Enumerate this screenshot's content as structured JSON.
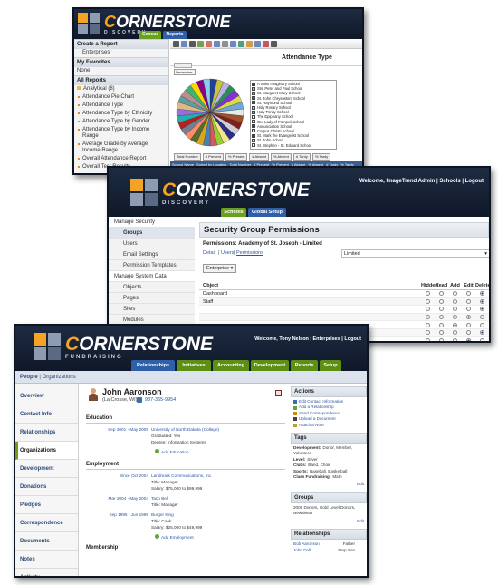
{
  "colors": {
    "navy": "#131d30",
    "green": "#5e8f15",
    "orange": "#f4a324",
    "link": "#2a56a3"
  },
  "brand": {
    "name_c": "C",
    "name_rest": "ORNERSTONE",
    "sub1": "DISCOVERY",
    "sub3": "FUNDRAISING"
  },
  "window1": {
    "tabs": [
      "Census",
      "Reports"
    ],
    "sidebar": {
      "create_header": "Create a Report",
      "create_item": "Enterprises",
      "favorites_header": "My Favorites",
      "favorites_item": "None",
      "all_header": "All Reports",
      "folder": "Analytical (8)",
      "items": [
        "Attendance Pie Chart",
        "Attendance Type",
        "Attendance Type by Ethnicity",
        "Attendance Type by Gender",
        "Attendance Type by Income Range",
        "Average Grade by Average Income Range",
        "Overall Attendance Report",
        "Overall Test Results"
      ]
    },
    "report_title": "Attendance Type",
    "filter_value": "December",
    "legend": [
      {
        "label": "A Saint Imaginary School",
        "color": "#1f3f9a"
      },
      {
        "label": "Sts. Peter and Paul School",
        "color": "#c9c23a"
      },
      {
        "label": "St. Margaret Mary School",
        "color": "#b5b5e0"
      },
      {
        "label": "St. John Chrysostom School",
        "color": "#2e8b57"
      },
      {
        "label": "St. Raymond School",
        "color": "#8a2be2"
      },
      {
        "label": "Holy Rosary School",
        "color": "#d9d94a"
      },
      {
        "label": "Holy Trinity School",
        "color": "#6fa8dc"
      },
      {
        "label": "The Epiphany School",
        "color": "#ffffff"
      },
      {
        "label": "Our Lady of Pompeii School",
        "color": "#ffffff"
      },
      {
        "label": "Annunciation School",
        "color": "#7f1f1f"
      },
      {
        "label": "Corpus Christi School",
        "color": "#e0e0e0"
      },
      {
        "label": "St. Mark the Evangelist School",
        "color": "#1f3f9a"
      },
      {
        "label": "St. John School",
        "color": "#ffffff"
      },
      {
        "label": "St. Stephen - St. Edward School",
        "color": "#ffffff"
      }
    ],
    "bottom_buttons": [
      "Total Number",
      "# Present",
      "% Present",
      "# Absent",
      "% Absent",
      "# Tardy",
      "% Tardy"
    ],
    "grid_header": [
      "School Name",
      "Sorted by Location",
      "Total Number",
      "# Present",
      "% Present",
      "# Absent",
      "% Absent",
      "# Tardy",
      "% Tardy"
    ],
    "nav_behind": [
      "Enterprise",
      "School",
      "Classroom",
      "Home",
      "Outcomes",
      "Finance",
      "Discovery",
      "Alumni",
      "Fundraising"
    ]
  },
  "window2": {
    "welcome": "Welcome, ImageTrend Admin | Schools | Logout",
    "tabs": [
      "Schools",
      "Global Setup"
    ],
    "sidebar": [
      {
        "label": "Manage Security",
        "type": "head"
      },
      {
        "label": "Groups",
        "type": "active"
      },
      {
        "label": "Users",
        "type": "sub"
      },
      {
        "label": "Email Settings",
        "type": "sub"
      },
      {
        "label": "Permission Templates",
        "type": "sub"
      },
      {
        "label": "Manage System Data",
        "type": "head"
      },
      {
        "label": "Objects",
        "type": "sub"
      },
      {
        "label": "Pages",
        "type": "sub"
      },
      {
        "label": "Sites",
        "type": "sub"
      },
      {
        "label": "Modules",
        "type": "sub"
      }
    ],
    "title": "Security Group Permissions",
    "subtitle": "Permissions: Academy of St. Joseph - Limited",
    "links": [
      "Detail",
      "Users",
      "Permissions"
    ],
    "select_value": "Limited",
    "enterprise_button": "Enterprise",
    "columns": [
      "Object",
      "Hidden",
      "Read",
      "Add",
      "Edit",
      "Delete"
    ],
    "rows": [
      {
        "name": "Dashboard",
        "sel": 4
      },
      {
        "name": "Staff",
        "sel": 4
      },
      {
        "name": "",
        "sel": 4
      },
      {
        "name": "",
        "sel": 3
      },
      {
        "name": "",
        "sel": 2
      },
      {
        "name": "",
        "sel": 4
      },
      {
        "name": "",
        "sel": 3
      },
      {
        "name": "",
        "sel": 4
      },
      {
        "name": "",
        "sel": 3
      },
      {
        "name": "",
        "sel": 4
      },
      {
        "name": "",
        "sel": 1
      },
      {
        "name": "",
        "sel": 4
      },
      {
        "name": "",
        "sel": 3
      },
      {
        "name": "",
        "sel": 4
      }
    ]
  },
  "window3": {
    "welcome": "Welcome, Tony Nelson | Enterprises | Logout",
    "tabs": [
      "Relationships",
      "Initiatives",
      "Accounting",
      "Development",
      "Reports",
      "Setup"
    ],
    "subbar": [
      "People",
      "Organizations"
    ],
    "sidebar": [
      "Overview",
      "Contact Info",
      "Relationships",
      "Organizations",
      "Development",
      "Donations",
      "Pledges",
      "Correspondence",
      "Documents",
      "Notes",
      "Activity"
    ],
    "active_sidebar": "Organizations",
    "person": {
      "name": "John Aaronson",
      "location": "(La Crosse, WI)",
      "phone": "987-365-9954"
    },
    "education_header": "Education",
    "education": [
      {
        "date": "Sep 2001 - May 2005",
        "lines": [
          "University of North Dakota (College)",
          "Graduated: Yes",
          "Degree: Information Systems"
        ]
      }
    ],
    "add_education": "Add Education",
    "employment_header": "Employment",
    "employment": [
      {
        "date": "Since Oct 2004",
        "lines": [
          "Landmark Communications, Inc.",
          "Title: Manager",
          "Salary: $75,000 to $99,999"
        ]
      },
      {
        "date": "Mar 2004 - May 2004",
        "lines": [
          "Taco Bell",
          "Title: Manager"
        ]
      },
      {
        "date": "Sep 1995 - Jun 1995",
        "lines": [
          "Burger King",
          "Title: Cook",
          "Salary: $25,000 to $49,999"
        ]
      }
    ],
    "add_employment": "Add Employment",
    "membership_header": "Membership",
    "actions_header": "Actions",
    "actions": [
      "Edit Contact Information",
      "Add a Relationship",
      "Send Correspondence",
      "Upload a Document",
      "Attach a Note"
    ],
    "tags_header": "Tags",
    "tags": [
      {
        "k": "Development:",
        "v": "Donor, Member, Volunteer"
      },
      {
        "k": "Level:",
        "v": "Silver"
      },
      {
        "k": "Clubs:",
        "v": "Band, Choir"
      },
      {
        "k": "Sports:",
        "v": "Baseball, Basketball"
      },
      {
        "k": "Class Fundraising:",
        "v": "Math"
      }
    ],
    "edit_label": "Edit",
    "groups_header": "Groups",
    "groups_text": "2008 Donors, Gold Level Donors, Newsletter",
    "relationships_header": "Relationships",
    "relationships": [
      {
        "name": "Bob Aaronson",
        "rel": "Father"
      },
      {
        "name": "John Doll",
        "rel": "Step Son"
      }
    ]
  }
}
